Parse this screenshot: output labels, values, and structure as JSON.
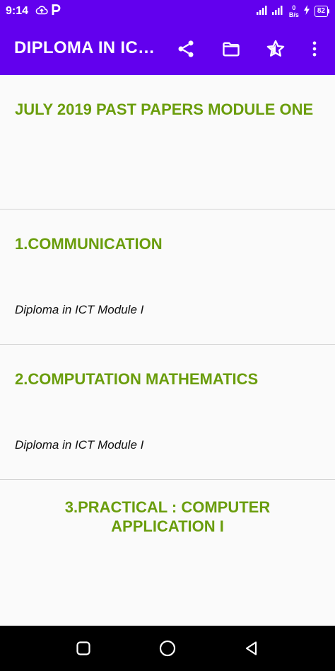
{
  "status_bar": {
    "time": "9:14",
    "left_icons": [
      "cloud-upload-icon",
      "p-icon"
    ],
    "speed_value": "0",
    "speed_unit": "B/s",
    "battery_level": "82"
  },
  "app_bar": {
    "title": "DIPLOMA IN ICT MODULE ONE PAST PAPERS",
    "actions": [
      "share-icon",
      "folder-icon",
      "star-icon",
      "more-vert-icon"
    ]
  },
  "items": [
    {
      "title": "JULY 2019 PAST PAPERS MODULE ONE",
      "subtitle": ""
    },
    {
      "title": "1.COMMUNICATION",
      "subtitle": "Diploma in ICT Module I"
    },
    {
      "title": "2.COMPUTATION MATHEMATICS",
      "subtitle": "Diploma in ICT Module I"
    },
    {
      "title": "3.PRACTICAL : COMPUTER APPLICATION I",
      "subtitle": ""
    }
  ],
  "nav_bar": {
    "buttons": [
      "recents-icon",
      "home-icon",
      "back-icon"
    ]
  },
  "colors": {
    "primary": "#6200ee",
    "title_green": "#6a9d0c",
    "divider": "#d4d4d4",
    "background": "#fafafa"
  }
}
